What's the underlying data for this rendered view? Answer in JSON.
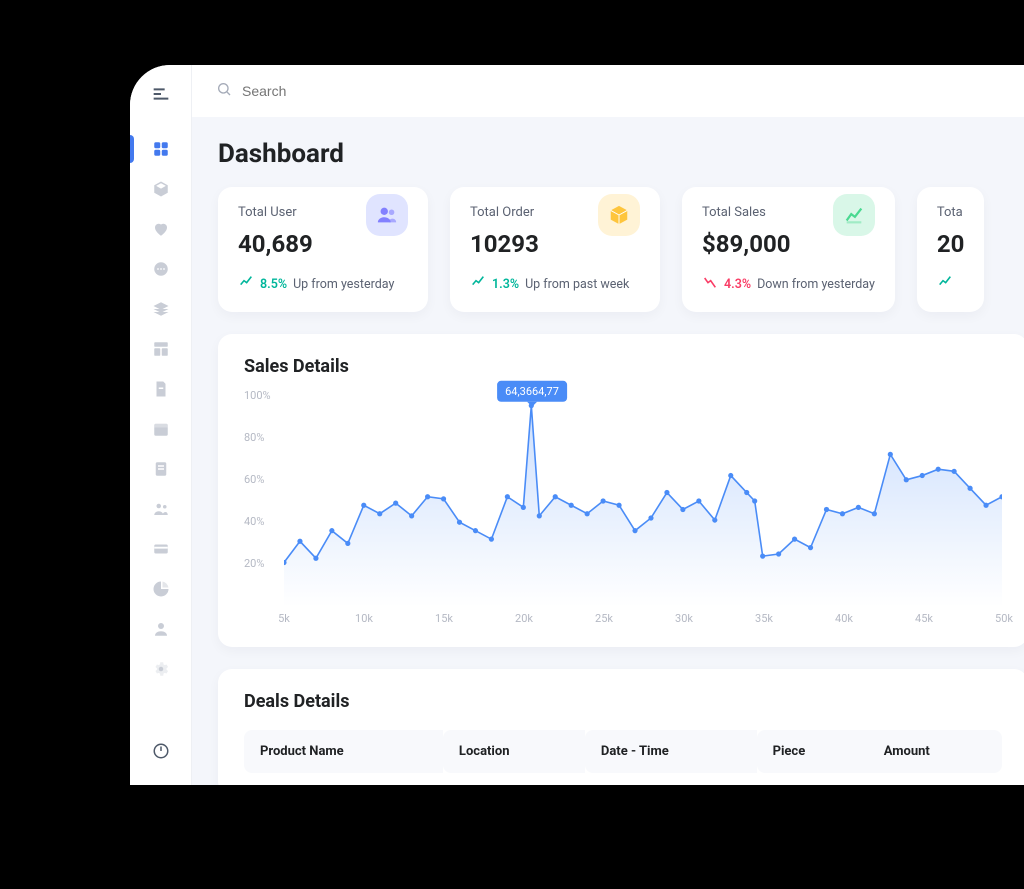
{
  "search": {
    "placeholder": "Search"
  },
  "page_title": "Dashboard",
  "cards": [
    {
      "title": "Total User",
      "value": "40,689",
      "trend_dir": "up",
      "trend_pct": "8.5%",
      "trend_text": "Up from yesterday",
      "icon": "users"
    },
    {
      "title": "Total Order",
      "value": "10293",
      "trend_dir": "up",
      "trend_pct": "1.3%",
      "trend_text": "Up from past week",
      "icon": "box"
    },
    {
      "title": "Total Sales",
      "value": "$89,000",
      "trend_dir": "down",
      "trend_pct": "4.3%",
      "trend_text": "Down from yesterday",
      "icon": "chart"
    },
    {
      "title": "Tota",
      "value": "20",
      "trend_dir": "up",
      "trend_pct": "",
      "trend_text": "",
      "icon": ""
    }
  ],
  "sales_panel": {
    "title": "Sales Details",
    "tooltip": "64,3664,77"
  },
  "deals_panel": {
    "title": "Deals Details",
    "columns": [
      "Product Name",
      "Location",
      "Date - Time",
      "Piece",
      "Amount"
    ]
  },
  "chart_data": {
    "type": "area",
    "title": "Sales Details",
    "xlabel": "",
    "ylabel": "",
    "ylim": [
      0,
      100
    ],
    "y_ticks": [
      "20%",
      "40%",
      "60%",
      "80%",
      "100%"
    ],
    "x_ticks": [
      "5k",
      "10k",
      "15k",
      "20k",
      "25k",
      "30k",
      "35k",
      "40k",
      "45k",
      "50k"
    ],
    "x": [
      5,
      6,
      7,
      8,
      9,
      10,
      11,
      12,
      13,
      14,
      15,
      16,
      17,
      18,
      19,
      20,
      20.5,
      21,
      22,
      23,
      24,
      25,
      26,
      27,
      28,
      29,
      30,
      31,
      32,
      33,
      34,
      34.5,
      35,
      36,
      37,
      38,
      39,
      40,
      41,
      42,
      43,
      44,
      45,
      46,
      47,
      48,
      49,
      50
    ],
    "values": [
      21,
      31,
      23,
      36,
      30,
      48,
      44,
      49,
      43,
      52,
      51,
      40,
      36,
      32,
      52,
      47,
      95,
      43,
      52,
      48,
      44,
      50,
      48,
      36,
      42,
      54,
      46,
      50,
      41,
      62,
      54,
      50,
      24,
      25,
      32,
      28,
      46,
      44,
      47,
      44,
      72,
      60,
      62,
      65,
      64,
      56,
      48,
      52
    ],
    "highlight": {
      "x": 20.5,
      "y": 95,
      "label": "64,3664,77"
    }
  }
}
